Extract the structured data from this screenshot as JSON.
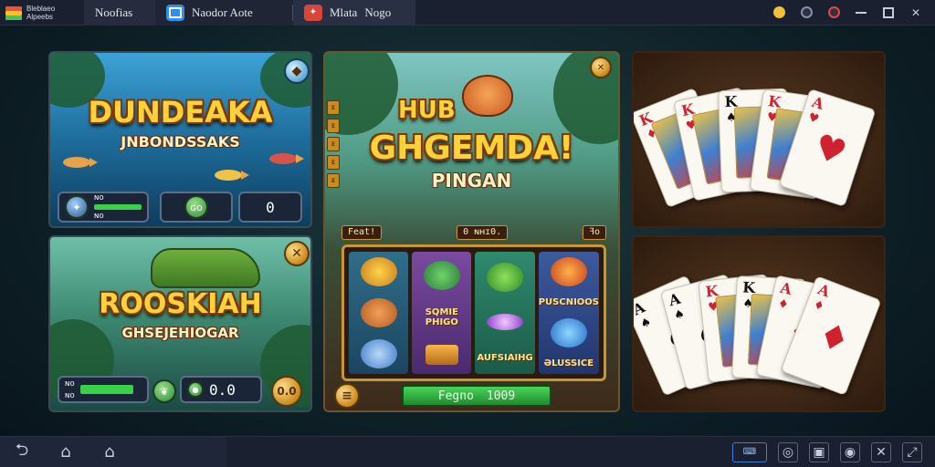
{
  "titlebar": {
    "brand_text": "Bleblaeo\nAlpeebs",
    "tabs": [
      {
        "label": "Noofias"
      },
      {
        "label": "Naodor Aote"
      },
      {
        "label": "Mlata",
        "label2": "Nogo"
      }
    ]
  },
  "panels": {
    "fish_game": {
      "title": "DUNDEAKA",
      "subtitle": "JNBONDSSAKS",
      "hud": {
        "stat_top": "ɴo",
        "stat_bottom": "ɴo",
        "center_badge": "ɢo",
        "score": "0"
      }
    },
    "dino_game": {
      "title": "ROOSKIAH",
      "subtitle": "GHSEJEHIOGAR",
      "hud": {
        "stat_top": "ɴo",
        "stat_bottom": "ɴo",
        "score": "0.0",
        "coin_label": "0.0"
      }
    },
    "slot_game": {
      "title_top": "HUB",
      "title_main": "GHGEMDA!",
      "title_sub": "PINGAN",
      "info_left": "Feat!",
      "info_center": "0 ɴʜɪ0.",
      "info_right": "ꟻo",
      "reel_text_1": "SQMIE\nPHIGO",
      "reel_text_2": "PUSCNIOOS",
      "reel_text_3": "AUFSIAIHG",
      "reel_text_4": "ƏLUSSICE",
      "spin_label": "Fegno",
      "spin_value": "1009"
    },
    "cards_top": {
      "cards": [
        {
          "rank": "K",
          "suit": "♦",
          "color": "red"
        },
        {
          "rank": "K",
          "suit": "♥",
          "color": "red"
        },
        {
          "rank": "K",
          "suit": "♠",
          "color": "blk"
        },
        {
          "rank": "K",
          "suit": "♥",
          "color": "red"
        },
        {
          "rank": "A",
          "suit": "♥",
          "color": "red"
        }
      ]
    },
    "cards_bottom": {
      "cards": [
        {
          "rank": "A",
          "suit": "♠",
          "color": "blk"
        },
        {
          "rank": "A",
          "suit": "♠",
          "color": "blk"
        },
        {
          "rank": "K",
          "suit": "♥",
          "color": "red"
        },
        {
          "rank": "K",
          "suit": "♠",
          "color": "blk"
        },
        {
          "rank": "A",
          "suit": "♦",
          "color": "red"
        },
        {
          "rank": "A",
          "suit": "♦",
          "color": "red"
        }
      ]
    }
  },
  "bottombar": {
    "keyboard_label": "⌨"
  },
  "colors": {
    "titlebar_bg": "#1b2030",
    "accent_gold": "#ffd23a",
    "accent_green": "#3ad14a",
    "card_red": "#d0212e"
  },
  "icons": {
    "brand": "app-logo-icon",
    "tabs": [
      "home-icon",
      "folder-icon",
      "game-icon"
    ],
    "window": [
      "bell-icon",
      "user-icon",
      "notification-icon",
      "minimize-icon",
      "maximize-icon",
      "close-icon"
    ],
    "nav": [
      "back-icon",
      "home-nav-icon",
      "recents-icon"
    ],
    "tools": [
      "keyboard-icon",
      "gamepad-icon",
      "screenshot-icon",
      "location-icon",
      "shake-icon",
      "fullscreen-icon"
    ]
  }
}
